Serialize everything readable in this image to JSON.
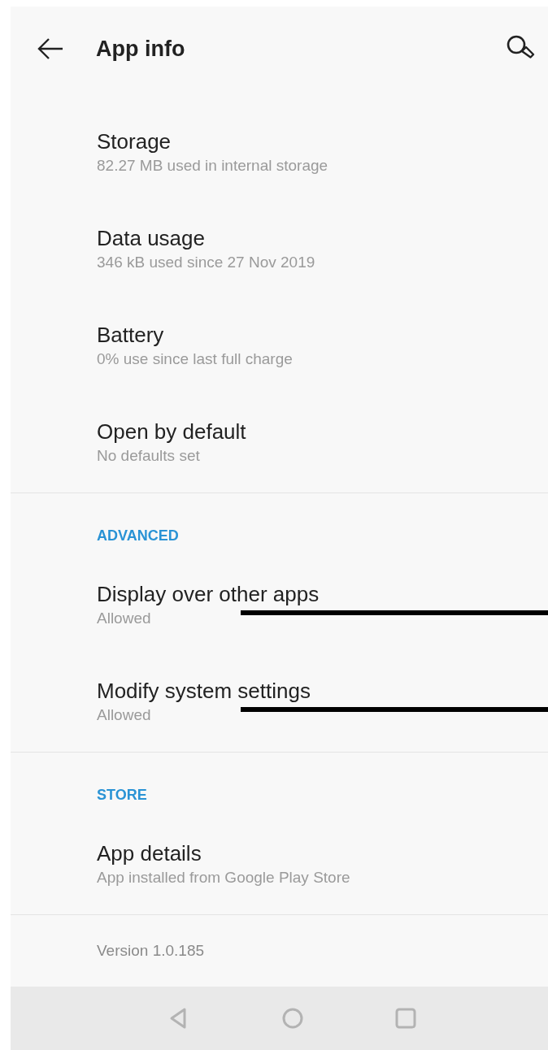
{
  "header": {
    "title": "App info"
  },
  "sections": [
    {
      "items": [
        {
          "title": "Storage",
          "summary": "82.27 MB used in internal storage",
          "redacted": false
        },
        {
          "title": "Data usage",
          "summary": "346 kB used since 27 Nov 2019",
          "redacted": false
        },
        {
          "title": "Battery",
          "summary": "0% use since last full charge",
          "redacted": false
        },
        {
          "title": "Open by default",
          "summary": "No defaults set",
          "redacted": false
        }
      ]
    },
    {
      "heading": "ADVANCED",
      "items": [
        {
          "title": "Display over other apps",
          "summary": "Allowed",
          "redacted": true
        },
        {
          "title": "Modify system settings",
          "summary": "Allowed",
          "redacted": true
        }
      ]
    },
    {
      "heading": "STORE",
      "items": [
        {
          "title": "App details",
          "summary": "App installed from Google Play Store",
          "redacted": false
        }
      ]
    }
  ],
  "version": "Version 1.0.185"
}
